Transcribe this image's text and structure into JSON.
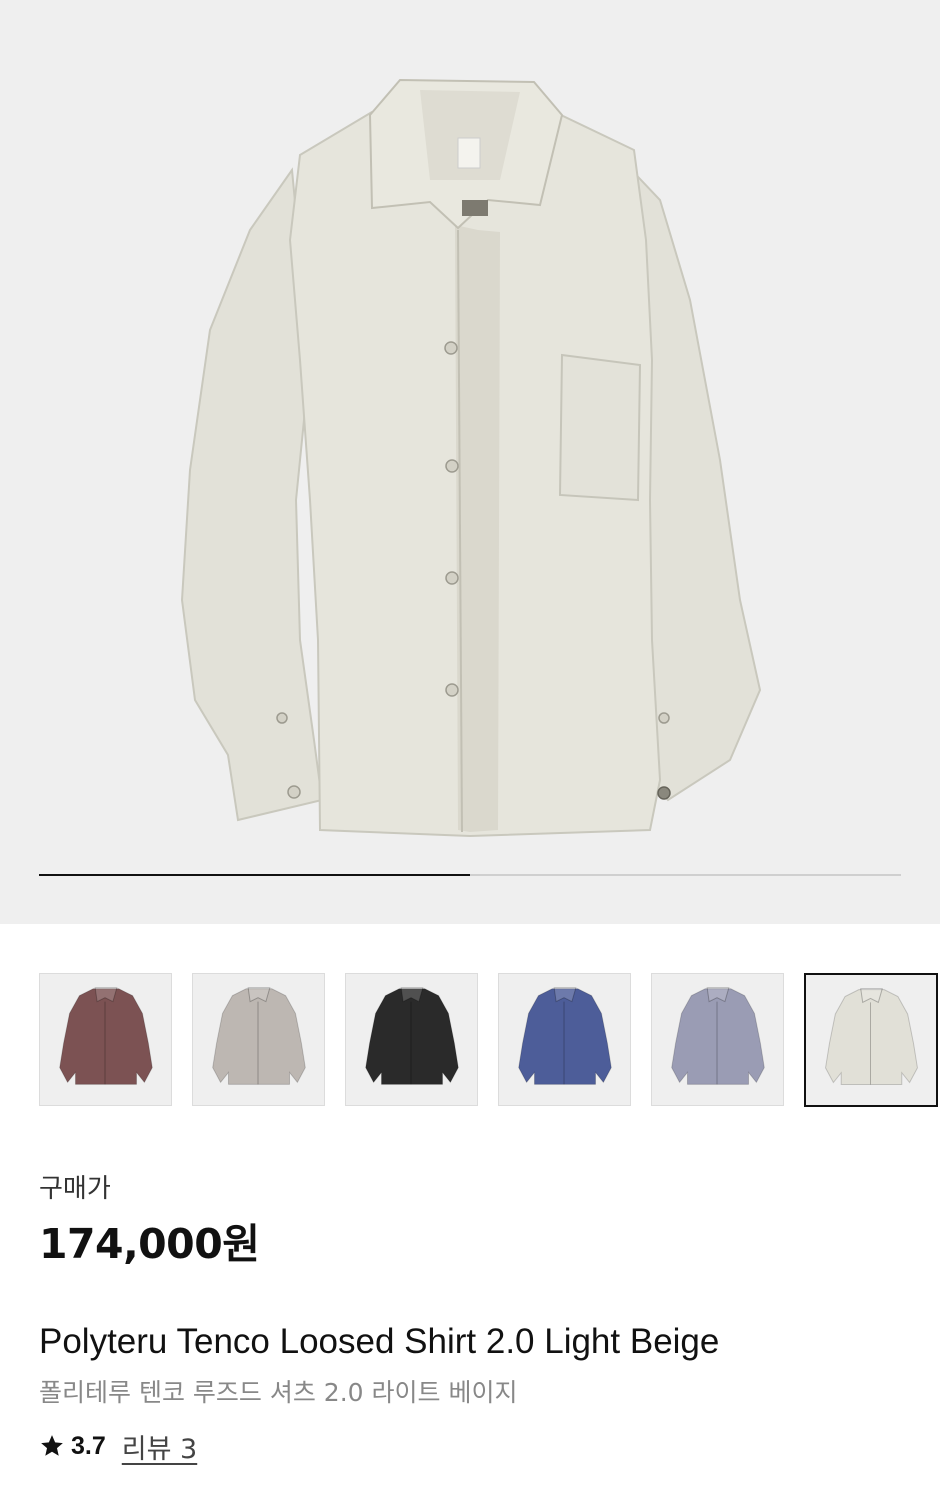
{
  "gallery": {
    "main_image": "light-beige-shirt",
    "progress_fraction": 0.5,
    "colors": {
      "background": "#efefef",
      "shirt": "#e4e3da",
      "progress_track": "#cfcfcf",
      "progress_fill": "#111111"
    }
  },
  "variants": [
    {
      "name": "burgundy-shirt",
      "color": "#7c5253"
    },
    {
      "name": "gray-beige-shirt",
      "color": "#bdb7b2"
    },
    {
      "name": "black-shirt",
      "color": "#2a2a2a"
    },
    {
      "name": "blue-shirt",
      "color": "#4d5d99"
    },
    {
      "name": "lavender-gray-shirt",
      "color": "#9a9cb4"
    },
    {
      "name": "light-beige-shirt",
      "color": "#e1e0d7",
      "selected": true
    }
  ],
  "product": {
    "price_label": "구매가",
    "price": "174,000원",
    "name_en": "Polyteru Tenco Loosed Shirt 2.0 Light Beige",
    "name_ko": "폴리테루 텐코 루즈드 셔츠 2.0 라이트 베이지",
    "rating": "3.7",
    "review_link": "리뷰 3",
    "rating_icon": "star-icon"
  }
}
